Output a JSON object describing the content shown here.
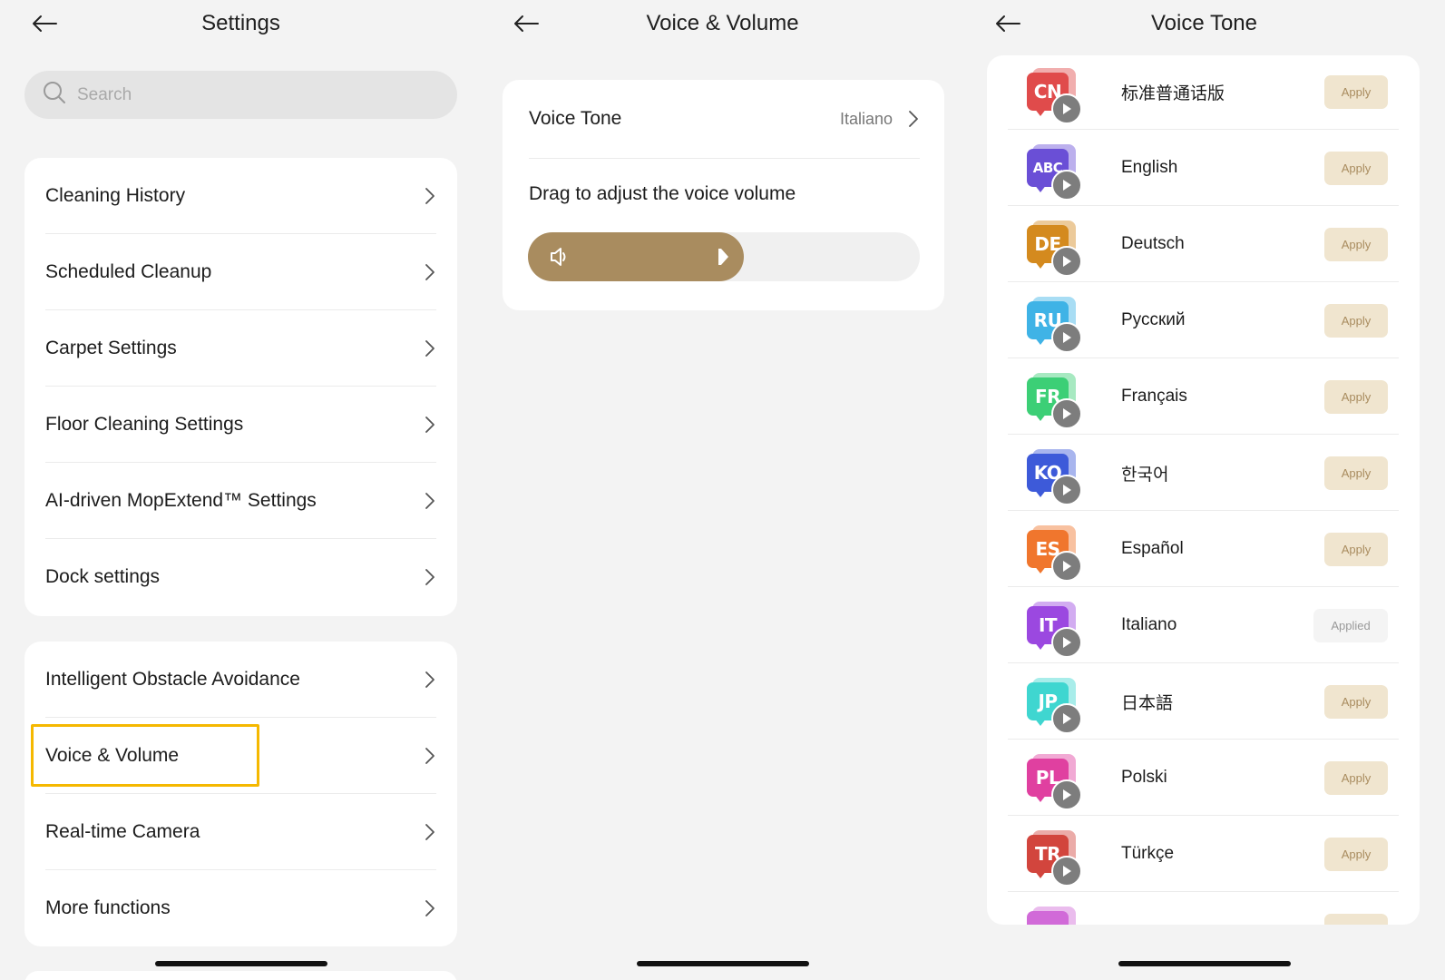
{
  "settings_panel": {
    "title": "Settings",
    "search_placeholder": "Search",
    "group1": [
      {
        "label": "Cleaning History"
      },
      {
        "label": "Scheduled Cleanup"
      },
      {
        "label": "Carpet Settings"
      },
      {
        "label": "Floor Cleaning Settings"
      },
      {
        "label": "AI-driven MopExtend™ Settings"
      },
      {
        "label": "Dock settings"
      }
    ],
    "group2": [
      {
        "label": "Intelligent Obstacle Avoidance"
      },
      {
        "label": "Voice & Volume"
      },
      {
        "label": "Real-time Camera"
      },
      {
        "label": "More functions"
      }
    ],
    "highlight_color": "#f5b800"
  },
  "voice_volume_panel": {
    "title": "Voice & Volume",
    "voice_tone_label": "Voice Tone",
    "voice_tone_value": "Italiano",
    "drag_label": "Drag to adjust the voice volume",
    "volume_level": 0.55,
    "accent_color": "#a98c5f"
  },
  "voice_tone_panel": {
    "title": "Voice Tone",
    "languages": [
      {
        "code": "CN",
        "name": "标准普通话版",
        "status": "Apply",
        "color": "#e04b4b"
      },
      {
        "code": "ABC",
        "name": "English",
        "status": "Apply",
        "color": "#6a4fd6"
      },
      {
        "code": "DE",
        "name": "Deutsch",
        "status": "Apply",
        "color": "#d48a1e"
      },
      {
        "code": "RU",
        "name": "Русский",
        "status": "Apply",
        "color": "#3fb3e6"
      },
      {
        "code": "FR",
        "name": "Français",
        "status": "Apply",
        "color": "#3ccf76"
      },
      {
        "code": "KO",
        "name": "한국어",
        "status": "Apply",
        "color": "#3d5ad9"
      },
      {
        "code": "ES",
        "name": "Español",
        "status": "Apply",
        "color": "#f0762d"
      },
      {
        "code": "IT",
        "name": "Italiano",
        "status": "Applied",
        "color": "#9b48e0"
      },
      {
        "code": "JP",
        "name": "日本語",
        "status": "Apply",
        "color": "#3fd6d0"
      },
      {
        "code": "PL",
        "name": "Polski",
        "status": "Apply",
        "color": "#e040a0"
      },
      {
        "code": "TR",
        "name": "Türkçe",
        "status": "Apply",
        "color": "#d2453d"
      }
    ]
  }
}
